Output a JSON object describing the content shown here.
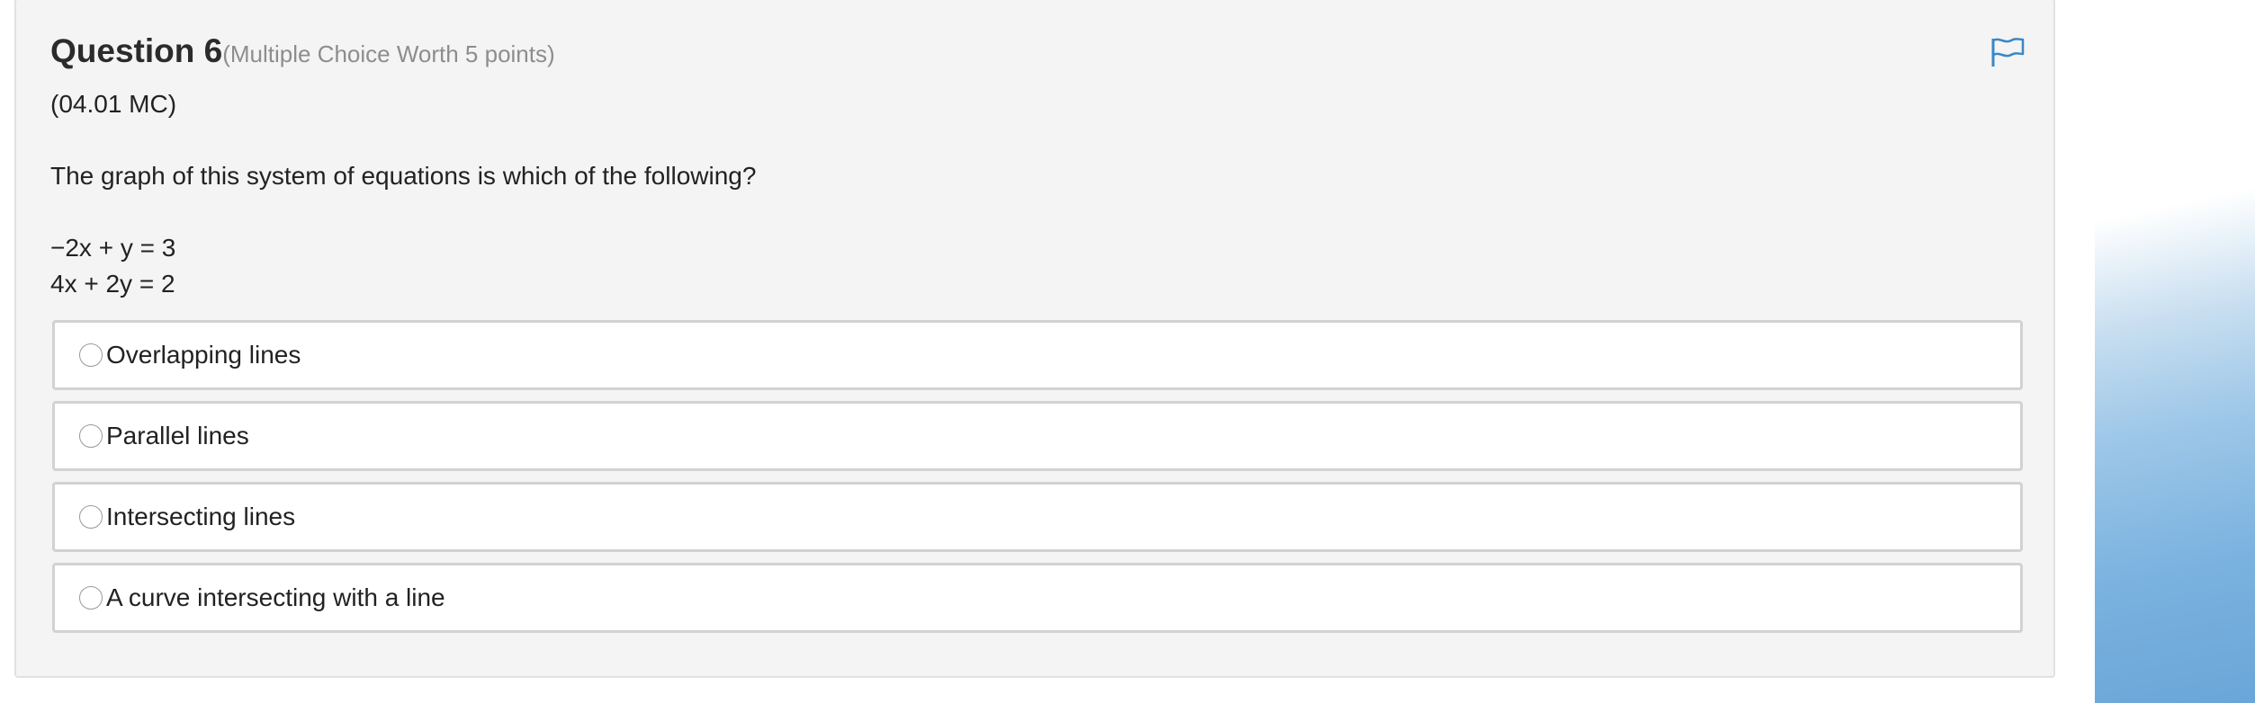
{
  "question": {
    "title": "Question 6",
    "points_text": "(Multiple Choice Worth 5 points)",
    "code": "(04.01 MC)",
    "prompt": "The graph of this system of equations is which of the following?",
    "equations": [
      "−2x + y = 3",
      "4x + 2y = 2"
    ],
    "flag_icon": "flag-icon",
    "accent_color": "#3a87c5"
  },
  "options": [
    {
      "label": "Overlapping lines",
      "selected": false
    },
    {
      "label": "Parallel lines",
      "selected": false
    },
    {
      "label": "Intersecting lines",
      "selected": false
    },
    {
      "label": "A curve intersecting with a line",
      "selected": false
    }
  ]
}
